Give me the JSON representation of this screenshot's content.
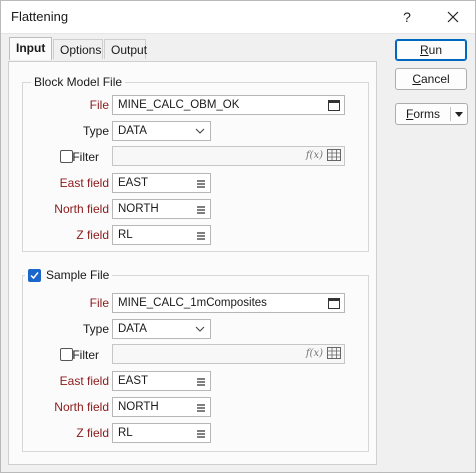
{
  "window": {
    "title": "Flattening",
    "help_glyph": "?"
  },
  "tabs": [
    {
      "label": "Input",
      "active": true
    },
    {
      "label": "Options",
      "active": false
    },
    {
      "label": "Output",
      "active": false
    }
  ],
  "buttons": {
    "run": {
      "label_ul": "R",
      "label_rest": "un"
    },
    "cancel": {
      "label_ul": "C",
      "label_rest": "ancel"
    },
    "forms": {
      "label_ul": "F",
      "label_rest": "orms"
    }
  },
  "block_model": {
    "group_title": "Block Model File",
    "file_label": "File",
    "file_value": "MINE_CALC_OBM_OK",
    "type_label": "Type",
    "type_value": "DATA",
    "filter_label": "Filter",
    "filter_checked": false,
    "filter_value": "",
    "fx_glyph": "f(x)",
    "east_label": "East field",
    "east_value": "EAST",
    "north_label": "North field",
    "north_value": "NORTH",
    "z_label": "Z field",
    "z_value": "RL"
  },
  "sample": {
    "group_title": "Sample File",
    "enabled": true,
    "file_label": "File",
    "file_value": "MINE_CALC_1mComposites",
    "type_label": "Type",
    "type_value": "DATA",
    "filter_label": "Filter",
    "filter_checked": false,
    "filter_value": "",
    "fx_glyph": "f(x)",
    "east_label": "East field",
    "east_value": "EAST",
    "north_label": "North field",
    "north_value": "NORTH",
    "z_label": "Z field",
    "z_value": "RL"
  },
  "colors": {
    "accent": "#0067c0",
    "required_label": "#8b1a1a",
    "checkbox_checked": "#1a66cc"
  }
}
